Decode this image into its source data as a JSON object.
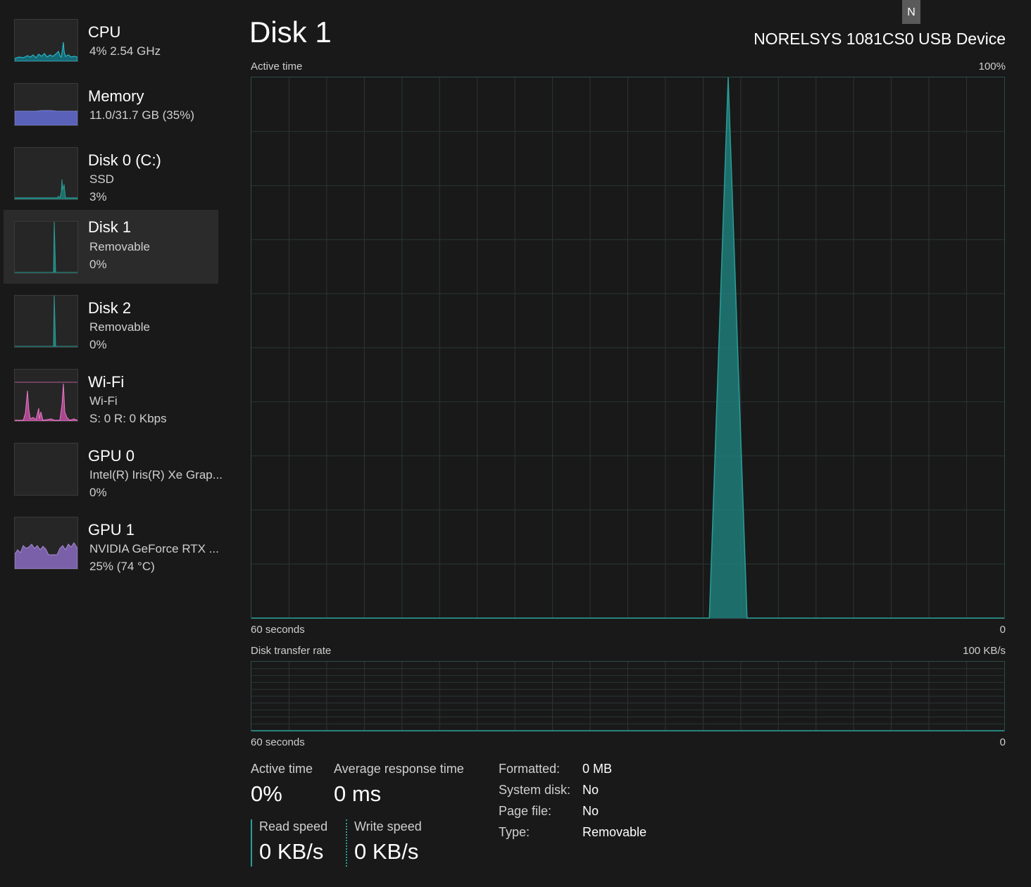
{
  "sidebar": {
    "items": [
      {
        "title": "CPU",
        "line1": "4%  2.54 GHz",
        "line2": ""
      },
      {
        "title": "Memory",
        "line1": "11.0/31.7 GB (35%)",
        "line2": ""
      },
      {
        "title": "Disk 0 (C:)",
        "line1": "SSD",
        "line2": "3%"
      },
      {
        "title": "Disk 1",
        "line1": "Removable",
        "line2": "0%"
      },
      {
        "title": "Disk 2",
        "line1": "Removable",
        "line2": "0%"
      },
      {
        "title": "Wi-Fi",
        "line1": "Wi-Fi",
        "line2": "S: 0  R: 0 Kbps"
      },
      {
        "title": "GPU 0",
        "line1": "Intel(R) Iris(R) Xe Grap...",
        "line2": "0%"
      },
      {
        "title": "GPU 1",
        "line1": "NVIDIA GeForce RTX ...",
        "line2": "25%  (74 °C)"
      }
    ]
  },
  "header": {
    "title": "Disk 1",
    "device": "NORELSYS 1081CS0 USB Device",
    "badge": "N"
  },
  "active_chart": {
    "label": "Active time",
    "max_label": "100%",
    "time_label": "60 seconds",
    "min_label": "0"
  },
  "transfer_chart": {
    "label": "Disk transfer rate",
    "max_label": "100 KB/s",
    "time_label": "60 seconds",
    "min_label": "0"
  },
  "stats": {
    "active_time_label": "Active time",
    "active_time_value": "0%",
    "avg_response_label": "Average response time",
    "avg_response_value": "0 ms",
    "read_label": "Read speed",
    "read_value": "0 KB/s",
    "write_label": "Write speed",
    "write_value": "0 KB/s"
  },
  "properties": [
    {
      "label": "Formatted:",
      "value": "0 MB"
    },
    {
      "label": "System disk:",
      "value": "No"
    },
    {
      "label": "Page file:",
      "value": "No"
    },
    {
      "label": "Type:",
      "value": "Removable"
    }
  ],
  "chart_data": [
    {
      "type": "area",
      "ylabel": "Active time",
      "ylim": [
        0,
        100
      ],
      "xlim": [
        60,
        0
      ],
      "x": [
        60,
        23.5,
        22,
        20.5,
        0
      ],
      "values": [
        0,
        0,
        100,
        0,
        0
      ]
    },
    {
      "type": "area",
      "ylabel": "Disk transfer rate",
      "ylim": [
        0,
        100
      ],
      "xlim": [
        60,
        0
      ],
      "x": [
        60,
        0
      ],
      "values": [
        0,
        0
      ]
    }
  ],
  "colors": {
    "disk": "#2a9d98",
    "disk_fill": "#1e7e7a",
    "memory": "#6a70c7",
    "wifi": "#e879c7",
    "gpu": "#9d7dc8",
    "cpu": "#27b5c8",
    "grid": "#2b3535"
  }
}
